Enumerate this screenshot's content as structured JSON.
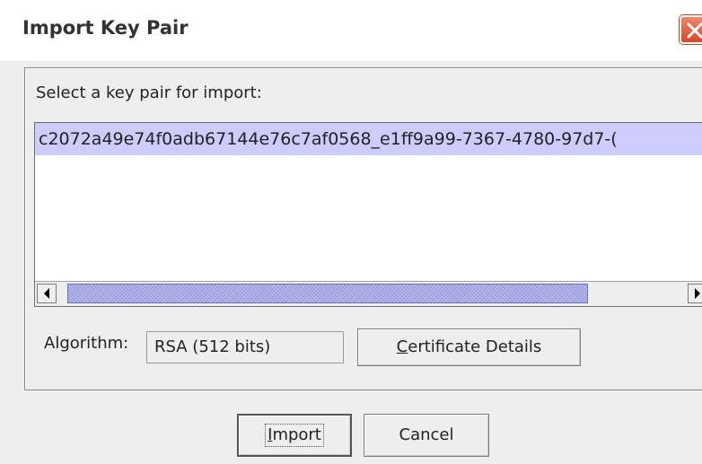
{
  "window": {
    "title": "Import Key Pair"
  },
  "panel": {
    "prompt": "Select a key pair for import:",
    "key_pairs": [
      "c2072a49e74f0adb67144e76c7af0568_e1ff9a99-7367-4780-97d7-("
    ],
    "selected_index": 0,
    "horizontal_scroll_fraction": 0.0,
    "algorithm_label": "Algorithm:",
    "algorithm_value": "RSA (512 bits)",
    "certificate_details": {
      "mnemonic": "C",
      "rest": "ertificate Details"
    }
  },
  "buttons": {
    "import": {
      "mnemonic": "I",
      "rest": "mport"
    },
    "cancel": "Cancel"
  },
  "icons": {
    "close": "close-icon",
    "scroll_left": "arrow-left-icon",
    "scroll_right": "arrow-right-icon"
  },
  "colors": {
    "selection": "#ccccff",
    "scroll_thumb": "#b9b9ec",
    "close_button": "#d9452a"
  }
}
